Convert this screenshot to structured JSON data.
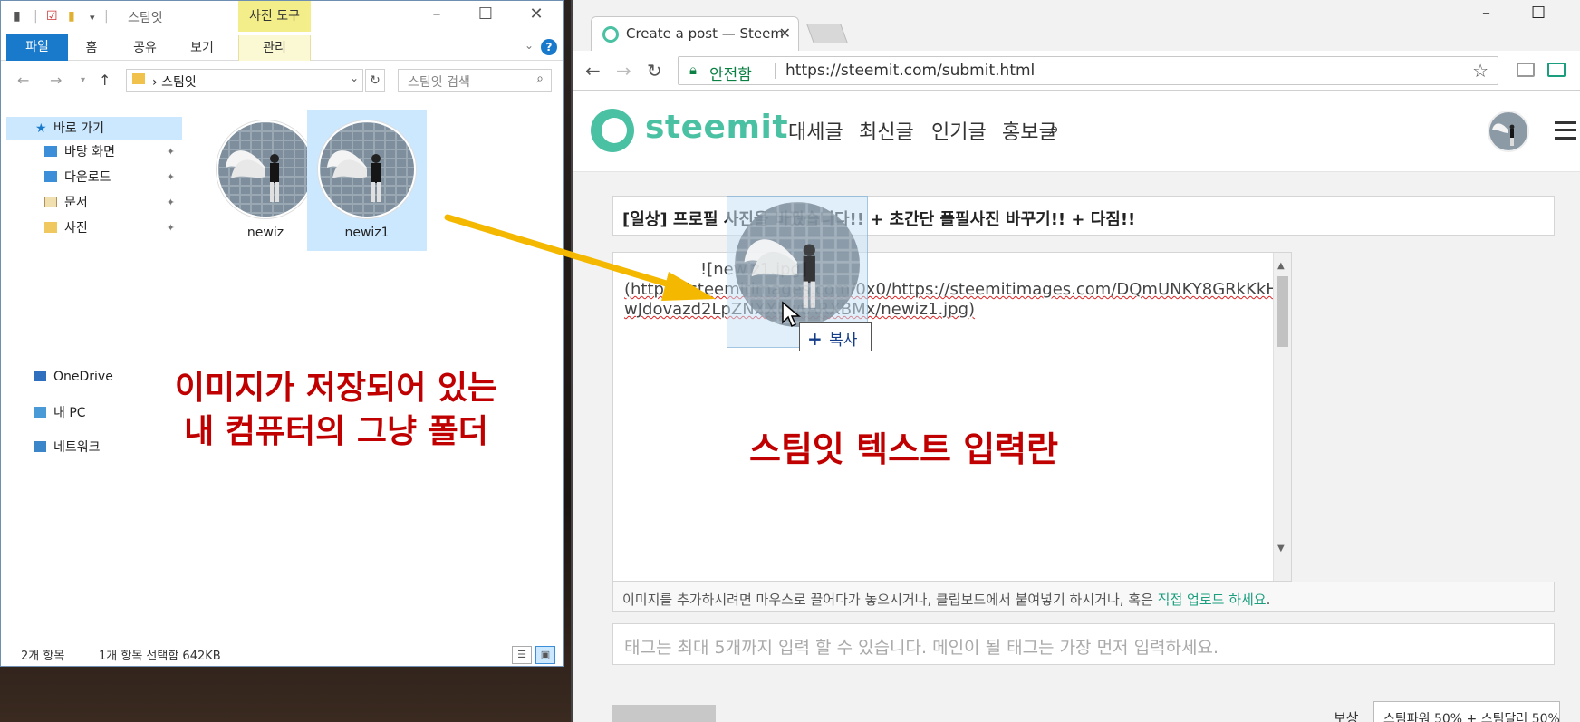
{
  "explorer": {
    "title": "스팀잇",
    "context_tab": "사진 도구",
    "ribbon_tabs": [
      "파일",
      "홈",
      "공유",
      "보기",
      "관리"
    ],
    "address_crumb": "스팀잇",
    "search_placeholder": "스팀잇 검색",
    "nav_items": [
      {
        "label": "바로 가기",
        "icon": "star-icon"
      },
      {
        "label": "바탕 화면",
        "icon": "folder-icon"
      },
      {
        "label": "다운로드",
        "icon": "folder-icon"
      },
      {
        "label": "문서",
        "icon": "document-icon"
      },
      {
        "label": "사진",
        "icon": "folder-icon"
      },
      {
        "label": "OneDrive",
        "icon": "onedrive-icon"
      },
      {
        "label": "내 PC",
        "icon": "computer-icon"
      },
      {
        "label": "네트워크",
        "icon": "network-icon"
      }
    ],
    "files": [
      {
        "name": "newiz",
        "selected": false
      },
      {
        "name": "newiz1",
        "selected": true
      }
    ],
    "status_count": "2개 항목",
    "status_selected": "1개 항목 선택함 642KB"
  },
  "annotations": {
    "left_line1": "이미지가 저장되어 있는",
    "left_line2": "내 컴퓨터의 그냥 폴더",
    "right": "스팀잇 텍스트 입력란"
  },
  "browser": {
    "tab_title": "Create a post — Steem",
    "secure_label": "안전함",
    "url": "https://steemit.com/submit.html"
  },
  "site": {
    "logo_text": "steemit",
    "menu": [
      "대세글",
      "최신글",
      "인기글",
      "홍보글"
    ],
    "post_title": "[일상] 프로필 사진을 바꿨습니다!! + 초간단 플필사진 바꾸기!! + 다짐!!",
    "body_line1": "![newiz1.jpg]",
    "body_line2": "(https://steemitimages.com/0x0/https://steemitimages.com/DQmUNKY8GRkKkH",
    "body_line3": "wJdovazd2LpZNXXbwtARXBMx/newiz1.jpg)",
    "hint_text": "이미지를 추가하시려면 마우스로 끌어다가 놓으시거나, 클립보드에서 붙여넣기 하시거나, 혹은 ",
    "hint_link": "직접 업로드 하세요",
    "hint_end": ".",
    "tags_placeholder": "태그는 최대 5개까지 입력 할 수 있습니다. 메인이 될 태그는 가장 먼저 입력하세요.",
    "reward_label": "보상",
    "reward_value": "스팀파워 50% + 스팀달러 50%"
  },
  "drag": {
    "copy_label": "복사"
  },
  "colors": {
    "steemit_green": "#4bc1a4",
    "annotation_red": "#c00000",
    "arrow_yellow": "#f5b800"
  }
}
